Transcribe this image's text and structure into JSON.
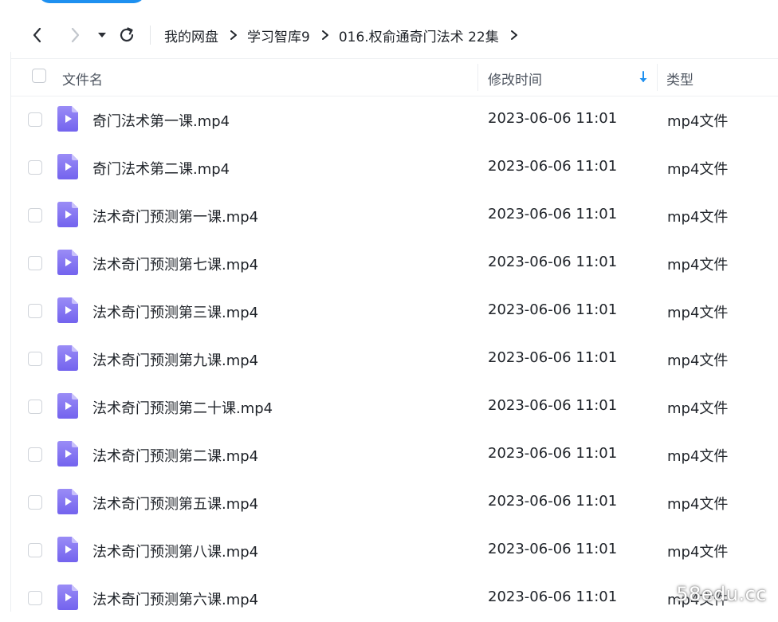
{
  "toolbar": {
    "back_icon": "chevron-left-icon",
    "forward_icon": "chevron-right-icon",
    "dropdown_icon": "caret-down-icon",
    "refresh_icon": "refresh-icon"
  },
  "breadcrumb": {
    "items": [
      "我的网盘",
      "学习智库9",
      "016.权俞通奇门法术 22集"
    ],
    "separator_icon": "chevron-right-icon"
  },
  "table": {
    "columns": {
      "name": "文件名",
      "modified": "修改时间",
      "type": "类型"
    },
    "sort_icon": "arrow-down-icon",
    "rows": [
      {
        "name": "奇门法术第一课.mp4",
        "modified": "2023-06-06 11:01",
        "type": "mp4文件"
      },
      {
        "name": "奇门法术第二课.mp4",
        "modified": "2023-06-06 11:01",
        "type": "mp4文件"
      },
      {
        "name": "法术奇门预测第一课.mp4",
        "modified": "2023-06-06 11:01",
        "type": "mp4文件"
      },
      {
        "name": "法术奇门预测第七课.mp4",
        "modified": "2023-06-06 11:01",
        "type": "mp4文件"
      },
      {
        "name": "法术奇门预测第三课.mp4",
        "modified": "2023-06-06 11:01",
        "type": "mp4文件"
      },
      {
        "name": "法术奇门预测第九课.mp4",
        "modified": "2023-06-06 11:01",
        "type": "mp4文件"
      },
      {
        "name": "法术奇门预测第二十课.mp4",
        "modified": "2023-06-06 11:01",
        "type": "mp4文件"
      },
      {
        "name": "法术奇门预测第二课.mp4",
        "modified": "2023-06-06 11:01",
        "type": "mp4文件"
      },
      {
        "name": "法术奇门预测第五课.mp4",
        "modified": "2023-06-06 11:01",
        "type": "mp4文件"
      },
      {
        "name": "法术奇门预测第八课.mp4",
        "modified": "2023-06-06 11:01",
        "type": "mp4文件"
      },
      {
        "name": "法术奇门预测第六课.mp4",
        "modified": "2023-06-06 11:01",
        "type": "mp4文件"
      }
    ]
  },
  "file_icon": "video-file-icon",
  "watermark": "58edu.cc",
  "colors": {
    "accent": "#1e90f0",
    "video_icon": "#7c6cf0",
    "text": "#1f2329",
    "header_text": "#4e5560"
  }
}
